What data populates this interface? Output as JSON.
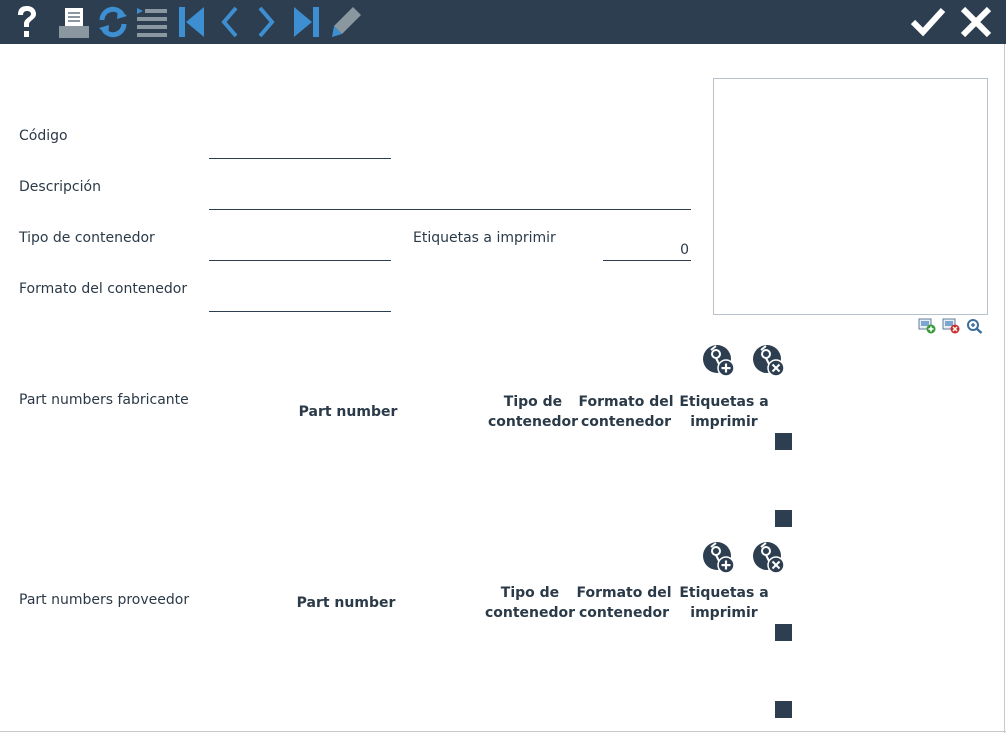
{
  "toolbar": {
    "buttons": [
      {
        "name": "help-icon"
      },
      {
        "name": "print-icon"
      },
      {
        "name": "refresh-icon"
      },
      {
        "name": "list-icon"
      },
      {
        "name": "first-record-icon"
      },
      {
        "name": "previous-record-icon"
      },
      {
        "name": "next-record-icon"
      },
      {
        "name": "last-record-icon"
      },
      {
        "name": "edit-pencil-icon"
      },
      {
        "name": "accept-check-icon"
      },
      {
        "name": "close-icon"
      }
    ],
    "colors": {
      "background": "#2c3e50",
      "accent": "#3d8fd1",
      "gray": "#8a96a0"
    }
  },
  "form": {
    "codigo": {
      "label": "Código",
      "value": ""
    },
    "descripcion": {
      "label": "Descripción",
      "value": ""
    },
    "tipo_contenedor": {
      "label": "Tipo de contenedor",
      "value": ""
    },
    "etiquetas": {
      "label": "Etiquetas a imprimir",
      "value": "0"
    },
    "formato_contenedor": {
      "label": "Formato del contenedor",
      "value": ""
    }
  },
  "image_panel": {
    "icons": [
      "add-image-icon",
      "remove-image-icon",
      "zoom-image-icon"
    ]
  },
  "fabricante": {
    "title": "Part numbers fabricante",
    "columns": {
      "part_number": "Part number",
      "tipo_1": "Tipo de",
      "tipo_2": "contenedor",
      "formato_1": "Formato del",
      "formato_2": "contenedor",
      "etiquetas_1": "Etiquetas a",
      "etiquetas_2": "imprimir"
    }
  },
  "proveedor": {
    "title": "Part numbers proveedor",
    "columns": {
      "part_number": "Part number",
      "tipo_1": "Tipo de",
      "tipo_2": "contenedor",
      "formato_1": "Formato del",
      "formato_2": "contenedor",
      "etiquetas_1": "Etiquetas a",
      "etiquetas_2": "imprimir"
    }
  }
}
